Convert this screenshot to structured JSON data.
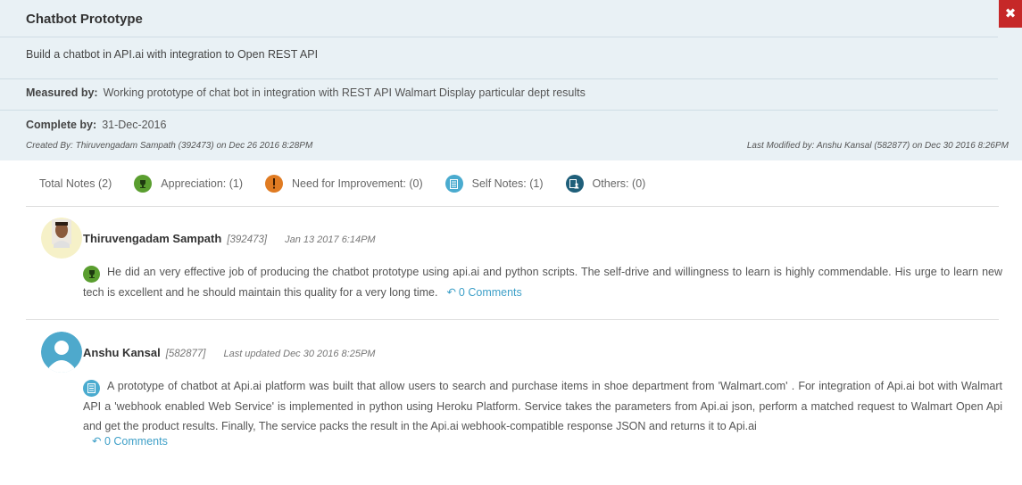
{
  "header": {
    "title": "Chatbot Prototype",
    "description": "Build a chatbot in API.ai with integration to Open REST API",
    "measured_label": "Measured by:",
    "measured_value": "Working prototype of chat bot in integration with REST API Walmart Display particular dept results",
    "complete_label": "Complete by:",
    "complete_value": "31-Dec-2016",
    "created_by": "Created By: Thiruvengadam Sampath (392473) on Dec 26 2016 8:28PM",
    "last_modified": "Last Modified by: Anshu Kansal (582877) on Dec 30 2016 8:26PM",
    "close_label": "✖"
  },
  "filters": {
    "total": "Total Notes",
    "total_count": "(2)",
    "appreciation": "Appreciation:",
    "appreciation_count": "(1)",
    "improvement": "Need for Improvement:",
    "improvement_count": "(0)",
    "self_notes": "Self Notes:",
    "self_notes_count": "(1)",
    "others": "Others:",
    "others_count": "(0)"
  },
  "notes": [
    {
      "author": "Thiruvengadam Sampath",
      "id": "[392473]",
      "date": "Jan 13 2017 6:14PM",
      "type_icon": "trophy-icon",
      "text": "He did an very effective job of producing the chatbot prototype using api.ai and python scripts. The self-drive and willingness to learn is highly commendable. His urge to learn new tech is excellent and he should maintain this quality for a very long time.",
      "comments": "0 Comments"
    },
    {
      "author": "Anshu Kansal",
      "id": "[582877]",
      "date": "Last updated Dec 30 2016 8:25PM",
      "type_icon": "notepad-icon",
      "text": "A prototype of chatbot at Api.ai platform was built that allow users to search and purchase items in shoe department from 'Walmart.com' . For integration of Api.ai bot with Walmart API a 'webhook enabled Web Service' is implemented in python using Heroku Platform. Service takes the parameters from Api.ai json, perform a matched request to Walmart Open Api and get the product results. Finally, The service packs the result in the Api.ai webhook-compatible response JSON and returns it to Api.ai",
      "comments": "0 Comments"
    }
  ],
  "colors": {
    "header_bg": "#e9f1f5",
    "close_bg": "#c62828",
    "appreciation": "#5a9e2f",
    "improvement": "#e07b22",
    "self_notes": "#4aabcf",
    "others": "#1f5f7a",
    "link": "#3fa0c8"
  }
}
